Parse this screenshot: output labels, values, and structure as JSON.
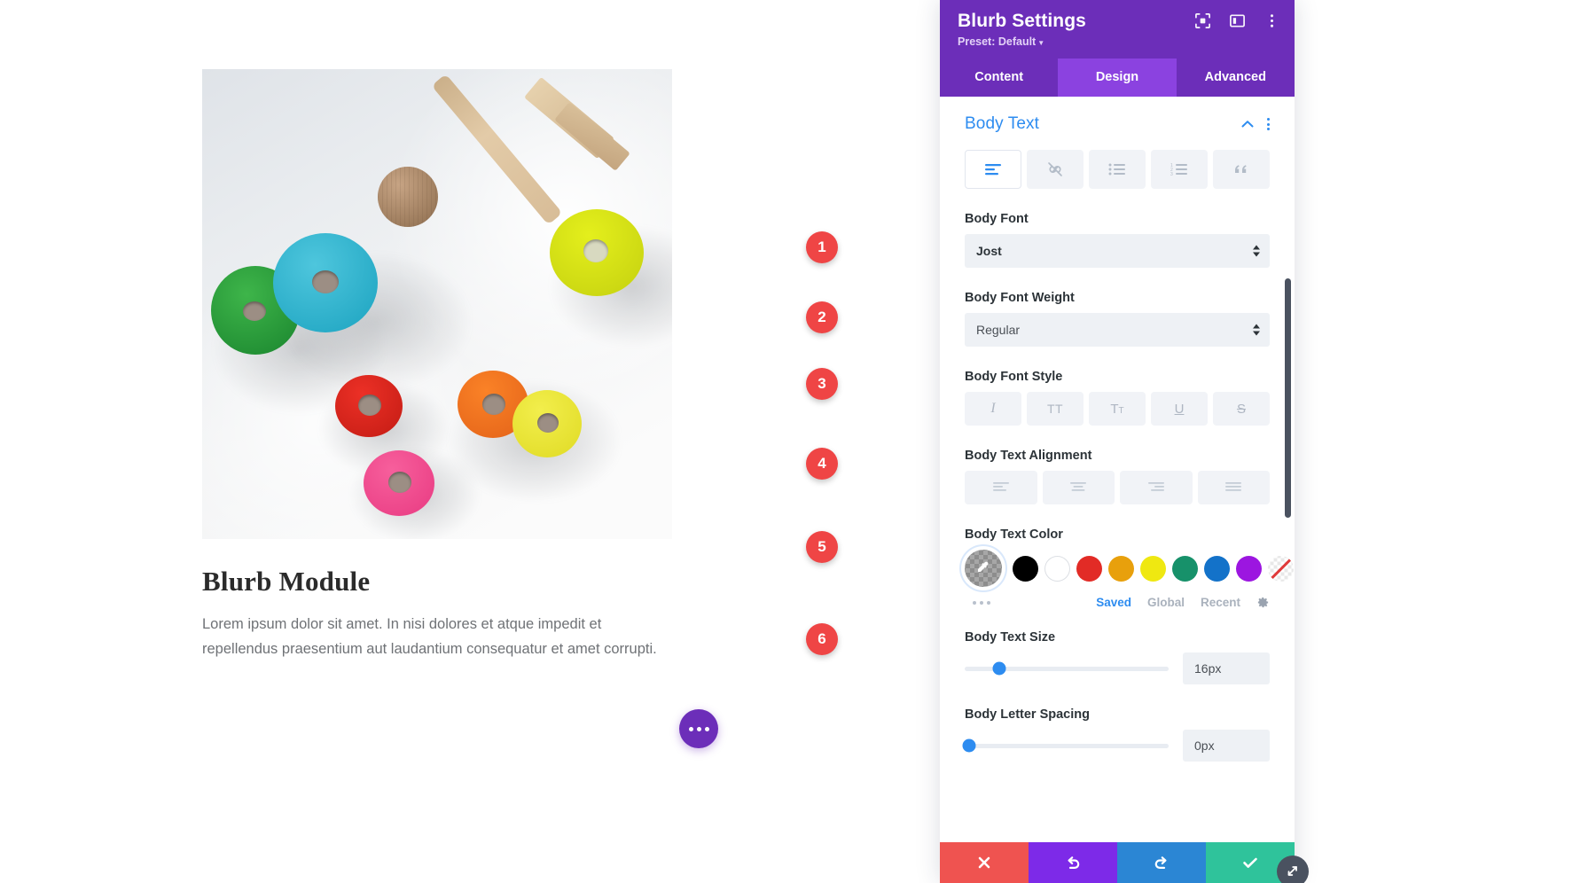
{
  "preview": {
    "blurb": {
      "title": "Blurb Module",
      "body": "Lorem ipsum dolor sit amet. In nisi dolores et atque impedit et repellendus praesentium aut laudantium consequatur et amet corrupti.",
      "image_alt": "wooden-toy-rings-and-hammer-photo"
    },
    "fab": "more-options"
  },
  "panel": {
    "title": "Blurb Settings",
    "preset_label": "Preset: Default",
    "header_icons": [
      "focus-icon",
      "layout-panel-icon",
      "vertical-dots-icon"
    ],
    "tabs": [
      {
        "label": "Content",
        "active": false
      },
      {
        "label": "Design",
        "active": true
      },
      {
        "label": "Advanced",
        "active": false
      }
    ],
    "section": {
      "title": "Body Text",
      "collapse_icon": "chevron-up-icon",
      "menu_icon": "vertical-dots-icon",
      "toggle_buttons": [
        {
          "icon": "paragraph-text-icon",
          "active": true
        },
        {
          "icon": "link-icon",
          "active": false
        },
        {
          "icon": "unordered-list-icon",
          "active": false
        },
        {
          "icon": "ordered-list-icon",
          "active": false
        },
        {
          "icon": "blockquote-icon",
          "active": false
        }
      ]
    },
    "fields": {
      "body_font": {
        "label": "Body Font",
        "value": "Jost",
        "badge": "1"
      },
      "body_font_weight": {
        "label": "Body Font Weight",
        "value": "Regular",
        "badge": "2"
      },
      "body_font_style": {
        "label": "Body Font Style",
        "badge": "3",
        "options": [
          {
            "glyph": "I",
            "name": "italic"
          },
          {
            "glyph": "TT",
            "name": "uppercase"
          },
          {
            "glyph": "T",
            "sub": "T",
            "name": "small-caps"
          },
          {
            "glyph": "U",
            "name": "underline"
          },
          {
            "glyph": "S",
            "name": "strikethrough"
          }
        ]
      },
      "body_text_alignment": {
        "label": "Body Text Alignment",
        "badge": "4",
        "options": [
          "align-left",
          "align-center",
          "align-right",
          "align-justify"
        ]
      },
      "body_text_color": {
        "label": "Body Text Color",
        "badge": "5",
        "picker": "eyedropper-icon",
        "swatches": [
          "#000000",
          "#ffffff",
          "#e22b26",
          "#e8a00c",
          "#efe811",
          "#17916a",
          "#1372c9",
          "#9c16e0"
        ],
        "none_swatch": "transparent-none",
        "more_icon": "horizontal-dots-icon",
        "palette_tabs": [
          {
            "label": "Saved",
            "active": true
          },
          {
            "label": "Global",
            "active": false
          },
          {
            "label": "Recent",
            "active": false
          }
        ],
        "settings_icon": "gear-icon"
      },
      "body_text_size": {
        "label": "Body Text Size",
        "badge": "6",
        "value": "16px",
        "slider_percent": 17
      },
      "body_letter_spacing": {
        "label": "Body Letter Spacing"
      }
    },
    "actions": [
      {
        "name": "close",
        "icon": "x-icon",
        "color": "#ef5350"
      },
      {
        "name": "undo",
        "icon": "undo-arrow-icon",
        "color": "#7d2ae8"
      },
      {
        "name": "redo",
        "icon": "redo-arrow-icon",
        "color": "#2b86d4"
      },
      {
        "name": "save",
        "icon": "check-icon",
        "color": "#2fc39b"
      }
    ],
    "resize_handle": "resize-diagonal-icon"
  }
}
